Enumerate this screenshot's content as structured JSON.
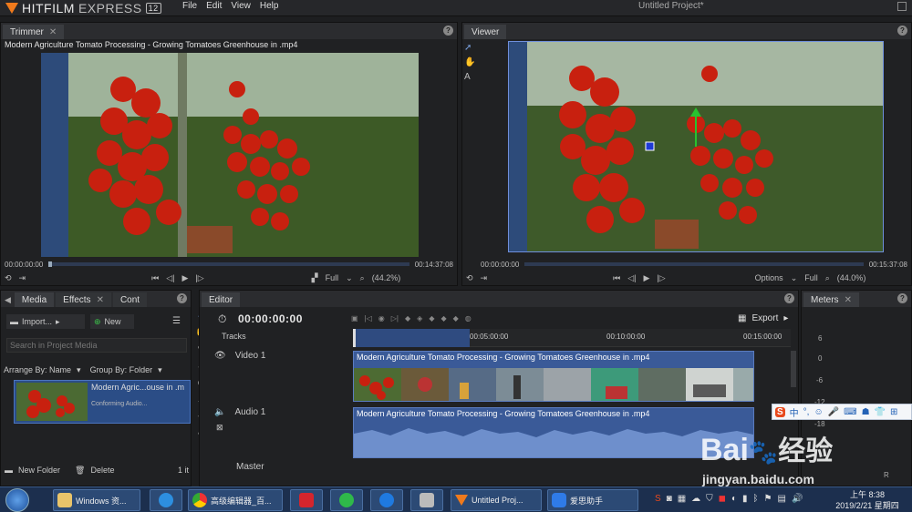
{
  "app": {
    "name_main": "HITFILM",
    "name_sub": "EXPRESS",
    "version": "12",
    "window_title": "Untitled Project*"
  },
  "menu": [
    "File",
    "Edit",
    "View",
    "Help"
  ],
  "trimmer": {
    "tab": "Trimmer",
    "clip_title": "Modern Agriculture Tomato Processing - Growing Tomatoes Greenhouse in .mp4",
    "time_start": "00:00:00:00",
    "time_end": "00:14:37:08",
    "quality": "Full",
    "zoom": "(44.2%)",
    "progress": 0.0
  },
  "viewer": {
    "tab": "Viewer",
    "time_start": "00:00:00:00",
    "time_end": "00:15:37:08",
    "options": "Options",
    "quality": "Full",
    "zoom": "(44.0%)"
  },
  "media": {
    "tabs": [
      "Media",
      "Effects",
      "Cont"
    ],
    "import_label": "Import...",
    "new_label": "New",
    "search_placeholder": "Search in Project Media",
    "arrange_label": "Arrange By: Name",
    "group_label": "Group By: Folder",
    "item_name": "Modern Agric...ouse in .m",
    "item_sub": "Conforming Audio...",
    "new_folder": "New Folder",
    "delete": "Delete",
    "count": "1 it"
  },
  "editor": {
    "tab": "Editor",
    "timecode": "00:00:00:00",
    "export": "Export",
    "tracks_label": "Tracks",
    "ruler": [
      "00:05:00:00",
      "00:10:00:00",
      "00:15:00:00"
    ],
    "video_track": "Video 1",
    "audio_track": "Audio 1",
    "master": "Master",
    "video_clip": "Modern Agriculture Tomato Processing - Growing Tomatoes Greenhouse in .mp4",
    "audio_clip": "Modern Agriculture Tomato Processing - Growing Tomatoes Greenhouse in .mp4"
  },
  "meters": {
    "tab": "Meters",
    "scale": [
      "6",
      "0",
      "-6",
      "-12",
      "-18"
    ],
    "channel": "R"
  },
  "ime_bar": "中",
  "watermark": {
    "brand": "Bai",
    "brand2": "经验",
    "url": "jingyan.baidu.com"
  },
  "taskbar": {
    "items": [
      "Windows 资...",
      "高级编辑器_百...",
      "",
      "",
      "",
      "Untitled Proj...",
      "爱思助手"
    ],
    "time": "上午 8:38",
    "date": "2019/2/21 星期四"
  }
}
